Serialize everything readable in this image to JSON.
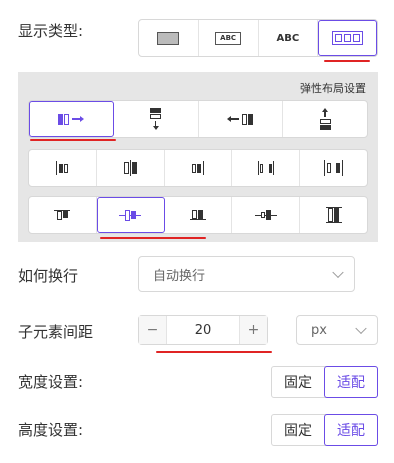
{
  "display_type": {
    "label": "显示类型:",
    "options": [
      {
        "icon": "block-display-icon"
      },
      {
        "icon": "inline-block-display-icon",
        "text": "ABC"
      },
      {
        "icon": "inline-display-icon",
        "text": "ABC"
      },
      {
        "icon": "flex-display-icon"
      }
    ],
    "selected": 3
  },
  "flex_panel": {
    "title": "弹性布局设置",
    "direction_options": [
      "row-icon",
      "column-icon",
      "row-reverse-icon",
      "column-reverse-icon"
    ],
    "direction_selected": 0,
    "justify_options": [
      "justify-start-icon",
      "justify-center-icon",
      "justify-end-icon",
      "justify-space-between-icon",
      "justify-space-around-icon"
    ],
    "align_options": [
      "align-start-icon",
      "align-center-icon",
      "align-end-icon",
      "align-baseline-icon",
      "align-stretch-icon"
    ],
    "align_selected": 1
  },
  "wrap": {
    "label": "如何换行",
    "value": "自动换行"
  },
  "gap": {
    "label": "子元素间距",
    "minus": "−",
    "value": "20",
    "plus": "+",
    "unit": "px"
  },
  "width": {
    "label": "宽度设置:",
    "options": [
      "固定",
      "适配"
    ],
    "selected": 1
  },
  "height": {
    "label": "高度设置:",
    "options": [
      "固定",
      "适配"
    ],
    "selected": 1
  },
  "colors": {
    "accent": "#6b4ce6",
    "annotation": "#e02424",
    "panel_bg": "#e6e6e6"
  }
}
